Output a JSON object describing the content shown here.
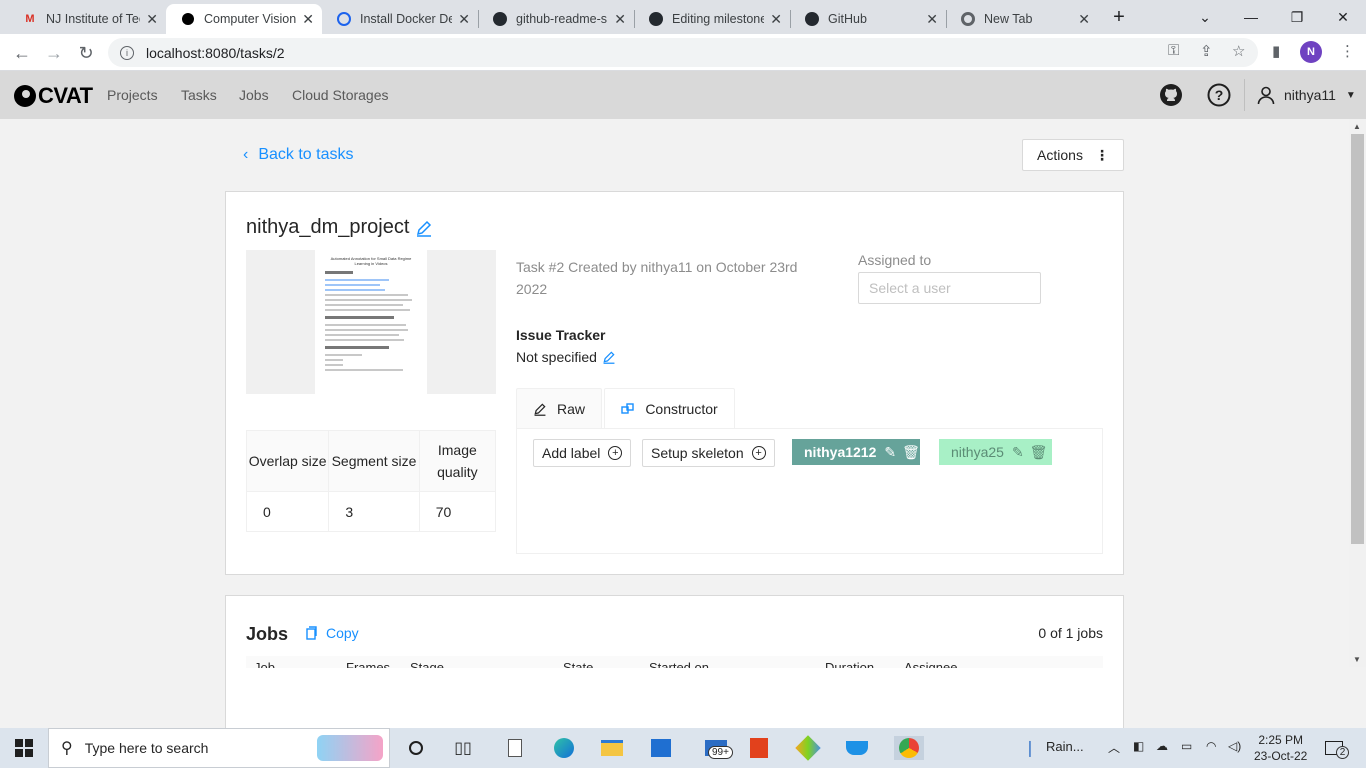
{
  "browser": {
    "tabs": [
      {
        "title": "NJ Institute of Tec",
        "favicon": "gmail-icon"
      },
      {
        "title": "Computer Vision",
        "favicon": "cvat-icon",
        "active": true
      },
      {
        "title": "Install Docker De",
        "favicon": "docker-icon"
      },
      {
        "title": "github-readme-s",
        "favicon": "github-icon"
      },
      {
        "title": "Editing milestone",
        "favicon": "github-icon"
      },
      {
        "title": "GitHub",
        "favicon": "github-icon"
      },
      {
        "title": "New Tab",
        "favicon": "chrome-icon"
      }
    ],
    "url": "localhost:8080/tasks/2",
    "profile_initial": "N"
  },
  "header": {
    "logo_text": "CVAT",
    "nav": [
      "Projects",
      "Tasks",
      "Jobs",
      "Cloud Storages"
    ],
    "username": "nithya11"
  },
  "page": {
    "back_label": "Back to tasks",
    "actions_label": "Actions",
    "task_name": "nithya_dm_project",
    "task_meta": "Task #2 Created by nithya11 on October 23rd 2022",
    "assigned_label": "Assigned to",
    "assigned_placeholder": "Select a user",
    "issue_tracker_label": "Issue Tracker",
    "issue_tracker_value": "Not specified",
    "params": {
      "headers": [
        "Overlap size",
        "Segment size",
        "Image quality"
      ],
      "values": [
        "0",
        "3",
        "70"
      ]
    },
    "label_tabs": [
      "Raw",
      "Constructor"
    ],
    "add_label": "Add label",
    "setup_skeleton": "Setup skeleton",
    "labels": [
      {
        "name": "nithya1212",
        "color": "#66a39a",
        "text_color": "#ffffff"
      },
      {
        "name": "nithya25",
        "color": "#a8f0c6",
        "text_color": "#5b8c75"
      }
    ],
    "preview_doc_title": "Automated Annotation for Small Data Regime Learning in Videos"
  },
  "jobs": {
    "title": "Jobs",
    "copy_label": "Copy",
    "count": "0 of 1 jobs",
    "columns": [
      "Job",
      "Frames",
      "Stage",
      "State",
      "Started on",
      "Duration",
      "Assignee"
    ]
  },
  "taskbar": {
    "search_placeholder": "Type here to search",
    "weather": "Rain...",
    "time": "2:25 PM",
    "date": "23-Oct-22",
    "mail_badge": "99+",
    "notif_count": "2"
  },
  "colors": {
    "link": "#1890ff",
    "header_bg": "#d9d9d9",
    "page_bg": "#f2f2f2"
  }
}
